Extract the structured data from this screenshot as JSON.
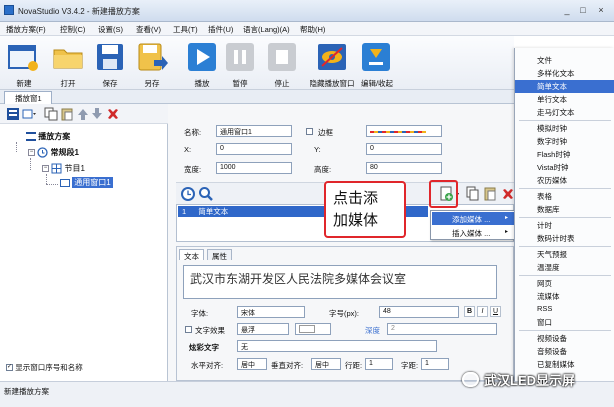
{
  "window": {
    "title": "NovaStudio V3.4.2 - 新建播放方案",
    "controls": [
      "_",
      "□",
      "×"
    ]
  },
  "menu": [
    "播放方案(F)",
    "控制(C)",
    "设置(S)",
    "查看(V)",
    "工具(T)",
    "插件(U)",
    "语言(Lang)(A)",
    "帮助(H)"
  ],
  "toolbar": [
    "新建",
    "打开",
    "保存",
    "另存",
    "播放",
    "暂停",
    "停止",
    "隐藏播放窗口",
    "编辑/收起"
  ],
  "doc_tab": "播放窗1",
  "tree": {
    "root": "播放方案",
    "segment": "常规段1",
    "program": "节目1",
    "window": "通用窗口1"
  },
  "window_props": {
    "name_label": "名称:",
    "name_value": "通用窗口1",
    "border_label": "边框",
    "x_label": "X:",
    "x_value": "0",
    "y_label": "Y:",
    "y_value": "0",
    "width_label": "宽度:",
    "width_value": "1000",
    "height_label": "高度:",
    "height_value": "80"
  },
  "media_list": {
    "row_index": "1",
    "row_name": "简单文本"
  },
  "context_menu": [
    "添加媒体 ...",
    "插入媒体 ..."
  ],
  "callout": {
    "line1": "点击添",
    "line2": "加媒体"
  },
  "prop_tabs": [
    "文本",
    "属性"
  ],
  "text_props": {
    "content": "武汉市东湖开发区人民法院多媒体会议室",
    "font_label": "字体:",
    "font_value": "宋体",
    "size_label": "字号(px):",
    "size_value": "48",
    "effect_label": "文字效果",
    "effect_value": "悬浮",
    "depth_label": "深度",
    "depth_value": "2",
    "color_text_label": "炫彩文字",
    "color_text_value": "无",
    "halign_label": "水平对齐:",
    "halign_value": "居中",
    "valign_label": "垂直对齐:",
    "valign_value": "居中",
    "line_spacing_label": "行距:",
    "line_spacing_value": "1",
    "char_spacing_label": "字距:",
    "char_spacing_value": "1",
    "fmt_buttons": [
      "B",
      "I",
      "U"
    ]
  },
  "show_names_label": "显示窗口序号和名称",
  "status": "新建播放方案",
  "media_menu": [
    "文件",
    "多样化文本",
    "简单文本",
    "单行文本",
    "走马灯文本",
    "模拟时钟",
    "数字时钟",
    "Flash时钟",
    "Vista时钟",
    "农历媒体",
    "表格",
    "数据库",
    "计时",
    "数码计时表",
    "天气预报",
    "温湿度",
    "网页",
    "流媒体",
    "RSS",
    "窗口",
    "视频设备",
    "音频设备",
    "已复制媒体"
  ],
  "watermark": "武汉LED显示屏",
  "colors": {
    "accent": "#3a6fd0",
    "highlight": "#e0262b",
    "titlebar": "#d7e2f1"
  }
}
